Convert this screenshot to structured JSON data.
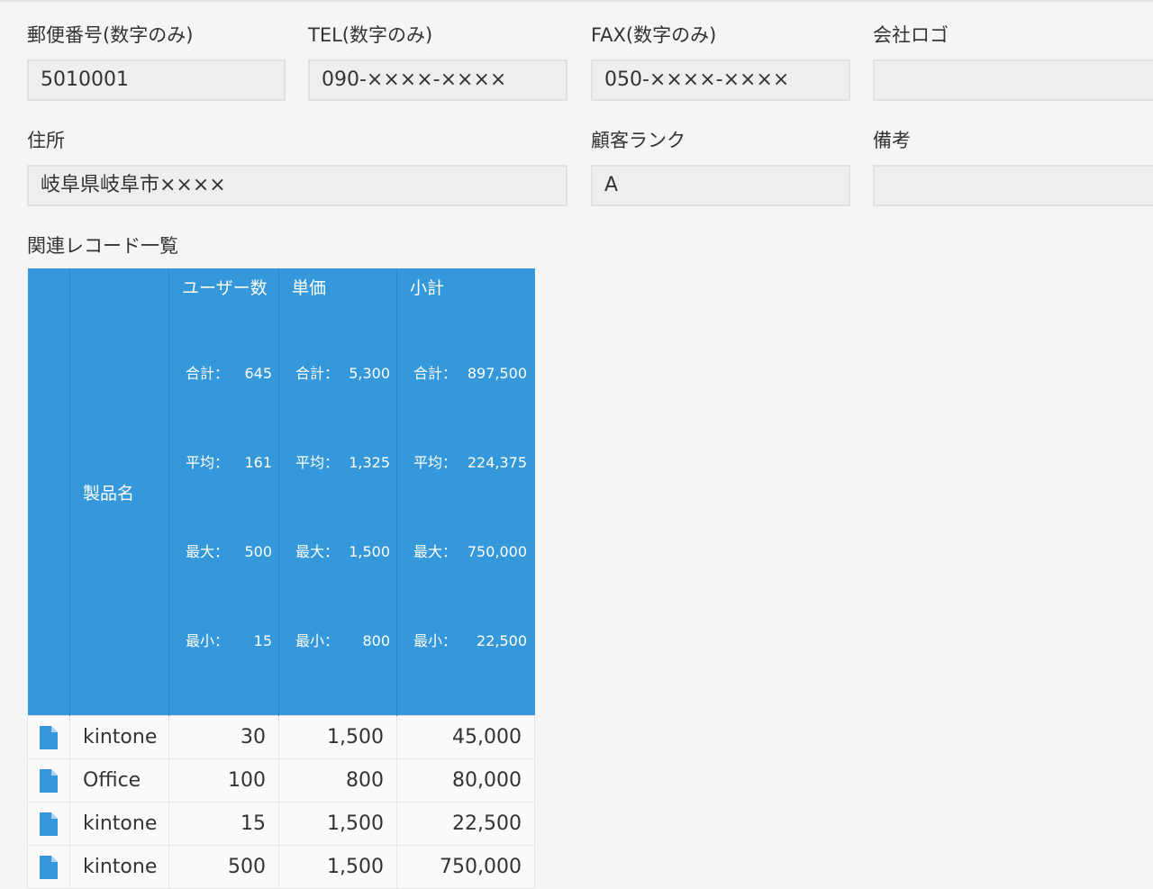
{
  "fields": {
    "zip": {
      "label": "郵便番号(数字のみ)",
      "value": "5010001"
    },
    "tel": {
      "label": "TEL(数字のみ)",
      "value": "090-××××-××××"
    },
    "fax": {
      "label": "FAX(数字のみ)",
      "value": "050-××××-××××"
    },
    "logo": {
      "label": "会社ロゴ",
      "value": ""
    },
    "address": {
      "label": "住所",
      "value": "岐阜県岐阜市××××"
    },
    "rank": {
      "label": "顧客ランク",
      "value": "A"
    },
    "note": {
      "label": "備考",
      "value": ""
    }
  },
  "related": {
    "title": "関連レコード一覧",
    "columns": {
      "product": "製品名",
      "users": {
        "label": "ユーザー数",
        "agg": [
          {
            "k": "合計：",
            "v": "645"
          },
          {
            "k": "平均：",
            "v": "161"
          },
          {
            "k": "最大：",
            "v": "500"
          },
          {
            "k": "最小：",
            "v": "15"
          }
        ]
      },
      "price": {
        "label": "単価",
        "agg": [
          {
            "k": "合計：",
            "v": "5,300"
          },
          {
            "k": "平均：",
            "v": "1,325"
          },
          {
            "k": "最大：",
            "v": "1,500"
          },
          {
            "k": "最小：",
            "v": "800"
          }
        ]
      },
      "subtotal": {
        "label": "小計",
        "agg": [
          {
            "k": "合計：",
            "v": "897,500"
          },
          {
            "k": "平均：",
            "v": "224,375"
          },
          {
            "k": "最大：",
            "v": "750,000"
          },
          {
            "k": "最小：",
            "v": "22,500"
          }
        ]
      }
    },
    "rows": [
      {
        "product": "kintone",
        "users": "30",
        "price": "1,500",
        "subtotal": "45,000"
      },
      {
        "product": "Office",
        "users": "100",
        "price": "800",
        "subtotal": "80,000"
      },
      {
        "product": "kintone",
        "users": "15",
        "price": "1,500",
        "subtotal": "22,500"
      },
      {
        "product": "kintone",
        "users": "500",
        "price": "1,500",
        "subtotal": "750,000"
      }
    ],
    "row_icon": "document-icon",
    "accent_color": "#3498db"
  }
}
